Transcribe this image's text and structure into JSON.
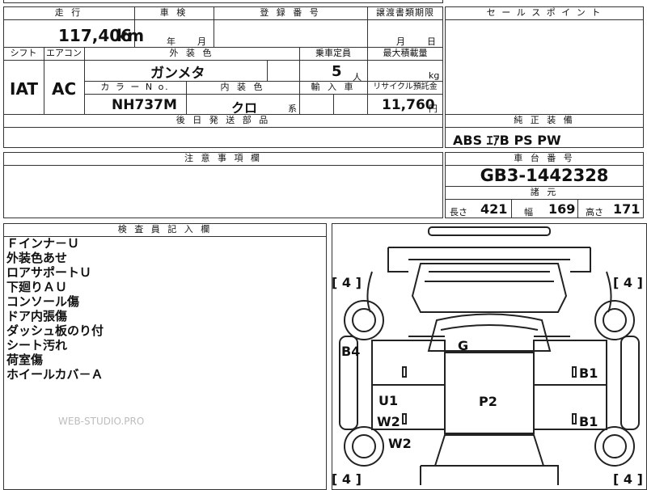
{
  "header_row": {
    "mileage_label": "走 行",
    "inspection_label": "車 検",
    "registration_label": "登 録 番 号",
    "transfer_label": "譲渡書類期限",
    "sales_point_label": "セ ー ル ス ポ イ ン ト"
  },
  "mileage": {
    "value": "117,406",
    "unit": "km"
  },
  "inspection": {
    "year_label": "年",
    "month_label": "月"
  },
  "transfer": {
    "month_label": "月",
    "day_label": "日"
  },
  "row2": {
    "shift_label": "シフト",
    "aircon_label": "エアコン",
    "exterior_label": "外 装 色",
    "capacity_label": "乗車定員",
    "max_load_label": "最大積載量"
  },
  "shift": {
    "value": "IAT"
  },
  "aircon": {
    "value": "AC"
  },
  "exterior_color": {
    "value": "ガンメタ"
  },
  "capacity": {
    "value": "5",
    "unit": "人"
  },
  "max_load": {
    "unit": "kg"
  },
  "row3": {
    "color_no_label": "カ ラ ー N o.",
    "interior_label": "内 装 色",
    "import_label": "輸 入 車",
    "recycle_label": "リサイクル預託金"
  },
  "color_no": {
    "value": "NH737M"
  },
  "interior": {
    "value": "クロ",
    "suffix": "系"
  },
  "recycle": {
    "value": "11,760",
    "unit": "円"
  },
  "later_parts_label": "後 日 発 送 部 品",
  "genuine_equipment": {
    "label": "純 正 装 備",
    "value": "ABS ｴｱB PS PW"
  },
  "caution_label": "注 意 事 項 欄",
  "chassis": {
    "label": "車 台 番 号",
    "value": "GB3-1442328"
  },
  "specs": {
    "label": "諸 元",
    "length_label": "長さ",
    "length": "421",
    "width_label": "幅",
    "width": "169",
    "height_label": "高さ",
    "height": "171"
  },
  "inspector_label": "検 査 員 記 入 欄",
  "inspector_notes": [
    "Ｆインナ－Ｕ",
    "外装色あせ",
    "ロアサポートＵ",
    "下廻りＡＵ",
    "コンソール傷",
    "ドア内張傷",
    "ダッシュ板のり付",
    "シート汚れ",
    "荷室傷",
    "ホイールカバ－Ａ"
  ],
  "watermark": "WEB-STUDIO.PRO",
  "diagram_marks": {
    "tire_fl": "4",
    "tire_fr": "4",
    "tire_rl": "4",
    "tire_rr": "4",
    "g": "G",
    "p2": "P2",
    "b4": "B4",
    "b1_front": "B1",
    "b1_rear": "B1",
    "u1": "U1",
    "w2_a": "W2",
    "w2_b": "W2"
  }
}
